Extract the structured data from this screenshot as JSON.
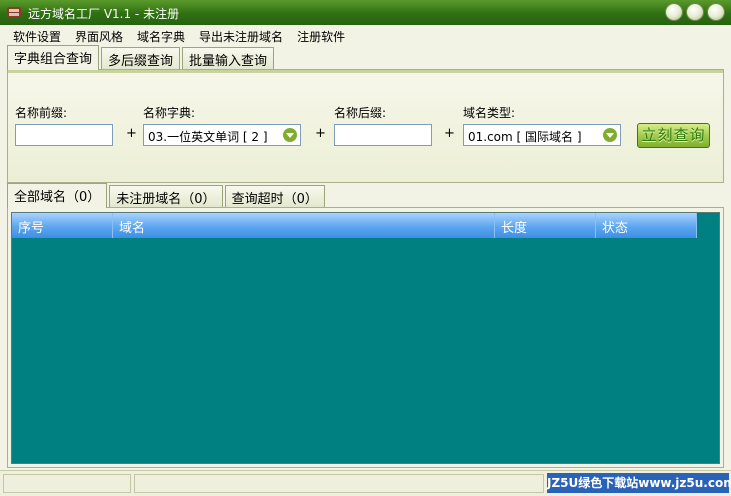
{
  "window": {
    "title": "远方域名工厂 V1.1 - 未注册"
  },
  "menu": [
    "软件设置",
    "界面风格",
    "域名字典",
    "导出未注册域名",
    "注册软件"
  ],
  "query_tabs": [
    "字典组合查询",
    "多后缀查询",
    "批量输入查询"
  ],
  "form": {
    "prefix_label": "名称前缀:",
    "prefix_value": "",
    "dict_label": "名称字典:",
    "dict_value": "03.一位英文单词 [ 2 ]",
    "suffix_label": "名称后缀:",
    "suffix_value": "",
    "type_label": "域名类型:",
    "type_value": "01.com [ 国际域名 ]",
    "plus": "+",
    "query_button": "立刻查询"
  },
  "result_tabs": [
    "全部域名（0）",
    "未注册域名（0）",
    "查询超时（0）"
  ],
  "table": {
    "columns": [
      "序号",
      "域名",
      "长度",
      "状态"
    ],
    "rows": []
  },
  "status": {
    "watermark": "JZ5U绿色下载站www.jz5u.com"
  },
  "colors": {
    "titlebar": "#2f6f12",
    "grid_bg": "#008080",
    "header": "#5ea6ef",
    "accent_green": "#9fc94a"
  },
  "icons": {
    "app": "app-icon",
    "dropdown": "dropdown-arrow-icon"
  }
}
